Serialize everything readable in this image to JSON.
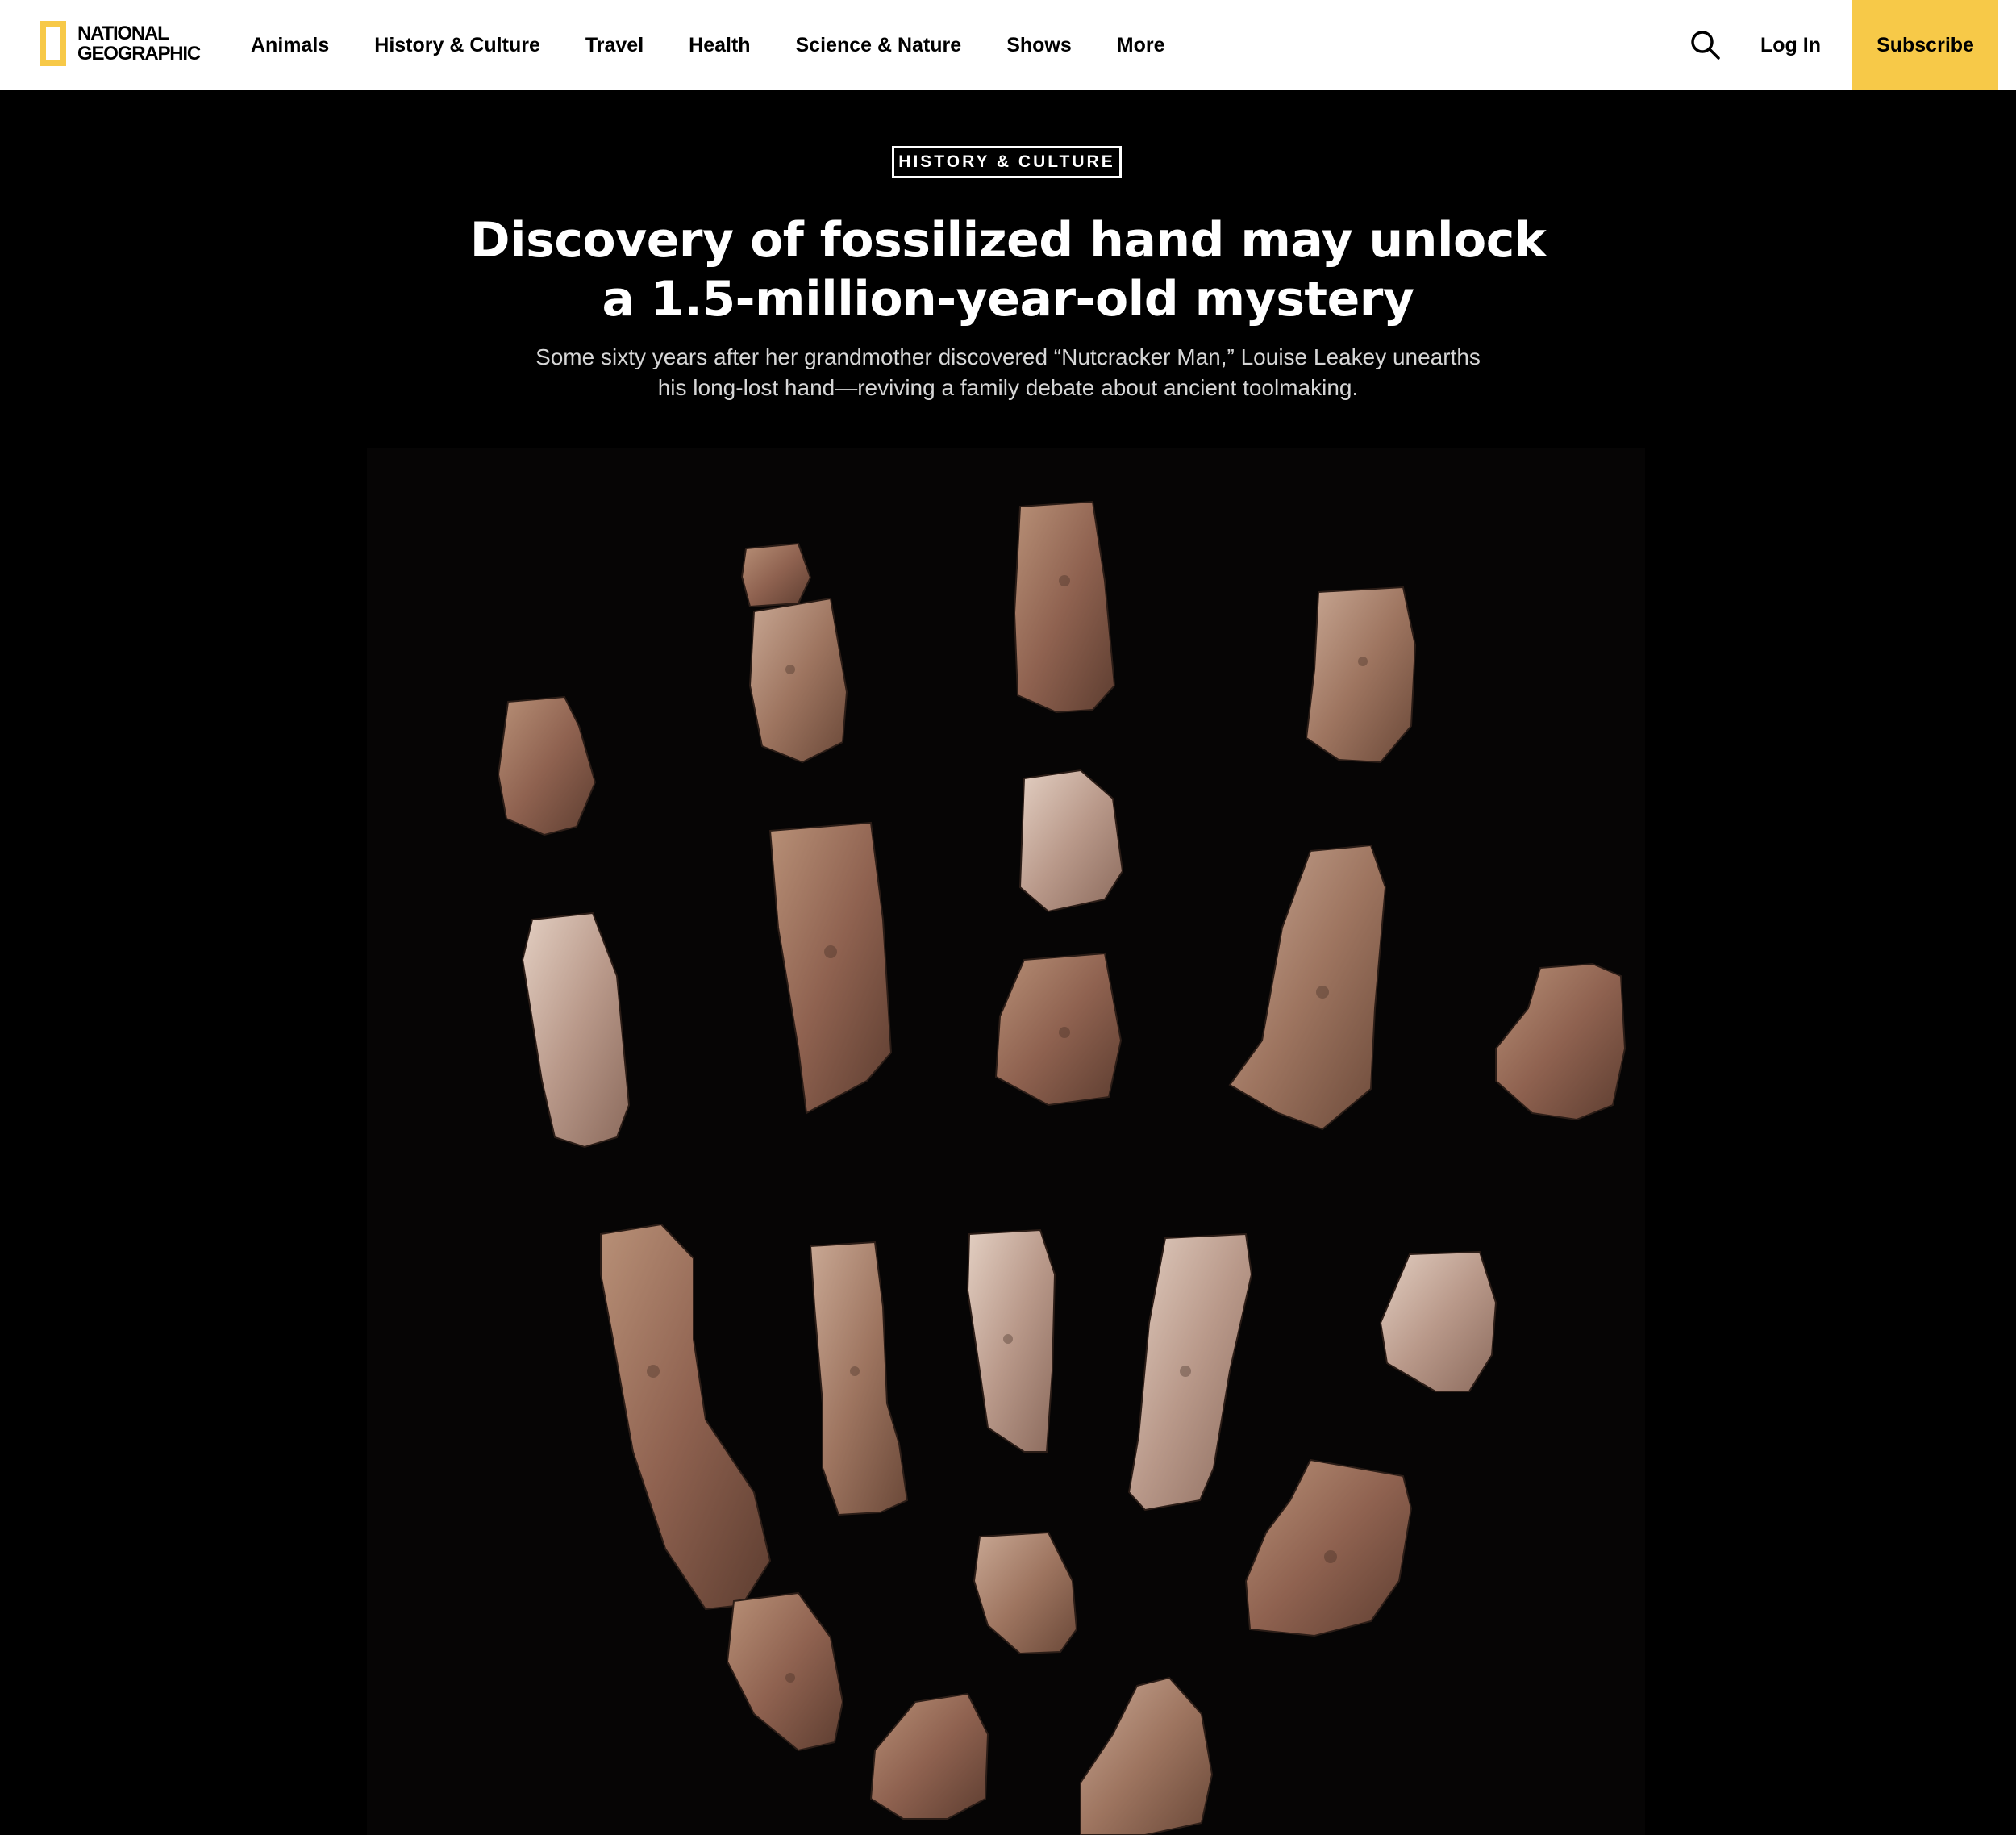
{
  "brand": {
    "logo_line1": "NATIONAL",
    "logo_line2": "GEOGRAPHIC",
    "accent_color": "#f7c948"
  },
  "nav": {
    "items": [
      {
        "label": "Animals"
      },
      {
        "label": "History & Culture"
      },
      {
        "label": "Travel"
      },
      {
        "label": "Health"
      },
      {
        "label": "Science & Nature"
      },
      {
        "label": "Shows"
      },
      {
        "label": "More"
      }
    ],
    "search_icon": "search-icon",
    "login_label": "Log In",
    "subscribe_label": "Subscribe"
  },
  "article": {
    "kicker": "HISTORY & CULTURE",
    "headline_line1": "Discovery of fossilized hand may unlock",
    "headline_line2": "a 1.5-million-year-old mystery",
    "dek_line1": "Some sixty years after her grandmother discovered “Nutcracker Man,” Louise Leakey unearths",
    "dek_line2": "his long-lost hand—reviving a family debate about ancient toolmaking."
  },
  "hero_image": {
    "subject": "fossil-hand-bones-photo",
    "background_color": "#000000"
  }
}
